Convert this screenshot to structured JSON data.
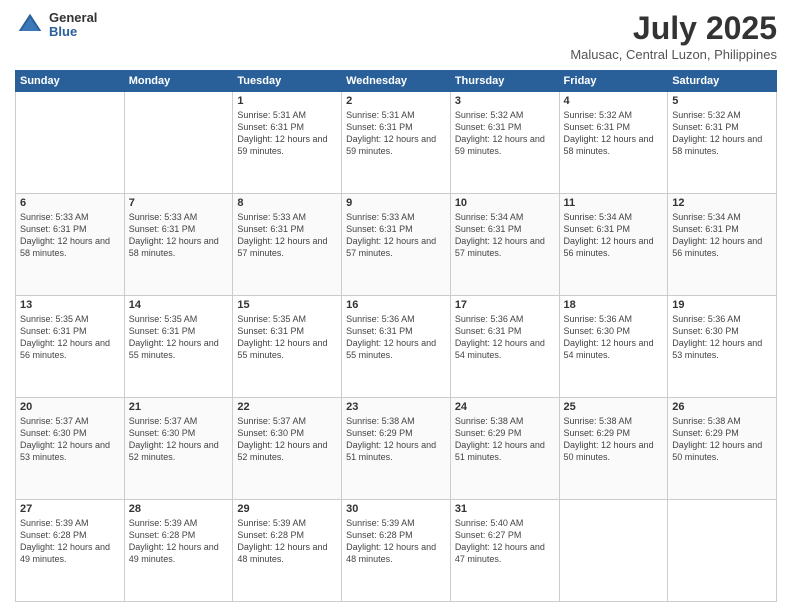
{
  "header": {
    "logo_general": "General",
    "logo_blue": "Blue",
    "month": "July 2025",
    "location": "Malusac, Central Luzon, Philippines"
  },
  "days_of_week": [
    "Sunday",
    "Monday",
    "Tuesday",
    "Wednesday",
    "Thursday",
    "Friday",
    "Saturday"
  ],
  "weeks": [
    [
      {
        "day": "",
        "info": ""
      },
      {
        "day": "",
        "info": ""
      },
      {
        "day": "1",
        "info": "Sunrise: 5:31 AM\nSunset: 6:31 PM\nDaylight: 12 hours and 59 minutes."
      },
      {
        "day": "2",
        "info": "Sunrise: 5:31 AM\nSunset: 6:31 PM\nDaylight: 12 hours and 59 minutes."
      },
      {
        "day": "3",
        "info": "Sunrise: 5:32 AM\nSunset: 6:31 PM\nDaylight: 12 hours and 59 minutes."
      },
      {
        "day": "4",
        "info": "Sunrise: 5:32 AM\nSunset: 6:31 PM\nDaylight: 12 hours and 58 minutes."
      },
      {
        "day": "5",
        "info": "Sunrise: 5:32 AM\nSunset: 6:31 PM\nDaylight: 12 hours and 58 minutes."
      }
    ],
    [
      {
        "day": "6",
        "info": "Sunrise: 5:33 AM\nSunset: 6:31 PM\nDaylight: 12 hours and 58 minutes."
      },
      {
        "day": "7",
        "info": "Sunrise: 5:33 AM\nSunset: 6:31 PM\nDaylight: 12 hours and 58 minutes."
      },
      {
        "day": "8",
        "info": "Sunrise: 5:33 AM\nSunset: 6:31 PM\nDaylight: 12 hours and 57 minutes."
      },
      {
        "day": "9",
        "info": "Sunrise: 5:33 AM\nSunset: 6:31 PM\nDaylight: 12 hours and 57 minutes."
      },
      {
        "day": "10",
        "info": "Sunrise: 5:34 AM\nSunset: 6:31 PM\nDaylight: 12 hours and 57 minutes."
      },
      {
        "day": "11",
        "info": "Sunrise: 5:34 AM\nSunset: 6:31 PM\nDaylight: 12 hours and 56 minutes."
      },
      {
        "day": "12",
        "info": "Sunrise: 5:34 AM\nSunset: 6:31 PM\nDaylight: 12 hours and 56 minutes."
      }
    ],
    [
      {
        "day": "13",
        "info": "Sunrise: 5:35 AM\nSunset: 6:31 PM\nDaylight: 12 hours and 56 minutes."
      },
      {
        "day": "14",
        "info": "Sunrise: 5:35 AM\nSunset: 6:31 PM\nDaylight: 12 hours and 55 minutes."
      },
      {
        "day": "15",
        "info": "Sunrise: 5:35 AM\nSunset: 6:31 PM\nDaylight: 12 hours and 55 minutes."
      },
      {
        "day": "16",
        "info": "Sunrise: 5:36 AM\nSunset: 6:31 PM\nDaylight: 12 hours and 55 minutes."
      },
      {
        "day": "17",
        "info": "Sunrise: 5:36 AM\nSunset: 6:31 PM\nDaylight: 12 hours and 54 minutes."
      },
      {
        "day": "18",
        "info": "Sunrise: 5:36 AM\nSunset: 6:30 PM\nDaylight: 12 hours and 54 minutes."
      },
      {
        "day": "19",
        "info": "Sunrise: 5:36 AM\nSunset: 6:30 PM\nDaylight: 12 hours and 53 minutes."
      }
    ],
    [
      {
        "day": "20",
        "info": "Sunrise: 5:37 AM\nSunset: 6:30 PM\nDaylight: 12 hours and 53 minutes."
      },
      {
        "day": "21",
        "info": "Sunrise: 5:37 AM\nSunset: 6:30 PM\nDaylight: 12 hours and 52 minutes."
      },
      {
        "day": "22",
        "info": "Sunrise: 5:37 AM\nSunset: 6:30 PM\nDaylight: 12 hours and 52 minutes."
      },
      {
        "day": "23",
        "info": "Sunrise: 5:38 AM\nSunset: 6:29 PM\nDaylight: 12 hours and 51 minutes."
      },
      {
        "day": "24",
        "info": "Sunrise: 5:38 AM\nSunset: 6:29 PM\nDaylight: 12 hours and 51 minutes."
      },
      {
        "day": "25",
        "info": "Sunrise: 5:38 AM\nSunset: 6:29 PM\nDaylight: 12 hours and 50 minutes."
      },
      {
        "day": "26",
        "info": "Sunrise: 5:38 AM\nSunset: 6:29 PM\nDaylight: 12 hours and 50 minutes."
      }
    ],
    [
      {
        "day": "27",
        "info": "Sunrise: 5:39 AM\nSunset: 6:28 PM\nDaylight: 12 hours and 49 minutes."
      },
      {
        "day": "28",
        "info": "Sunrise: 5:39 AM\nSunset: 6:28 PM\nDaylight: 12 hours and 49 minutes."
      },
      {
        "day": "29",
        "info": "Sunrise: 5:39 AM\nSunset: 6:28 PM\nDaylight: 12 hours and 48 minutes."
      },
      {
        "day": "30",
        "info": "Sunrise: 5:39 AM\nSunset: 6:28 PM\nDaylight: 12 hours and 48 minutes."
      },
      {
        "day": "31",
        "info": "Sunrise: 5:40 AM\nSunset: 6:27 PM\nDaylight: 12 hours and 47 minutes."
      },
      {
        "day": "",
        "info": ""
      },
      {
        "day": "",
        "info": ""
      }
    ]
  ]
}
